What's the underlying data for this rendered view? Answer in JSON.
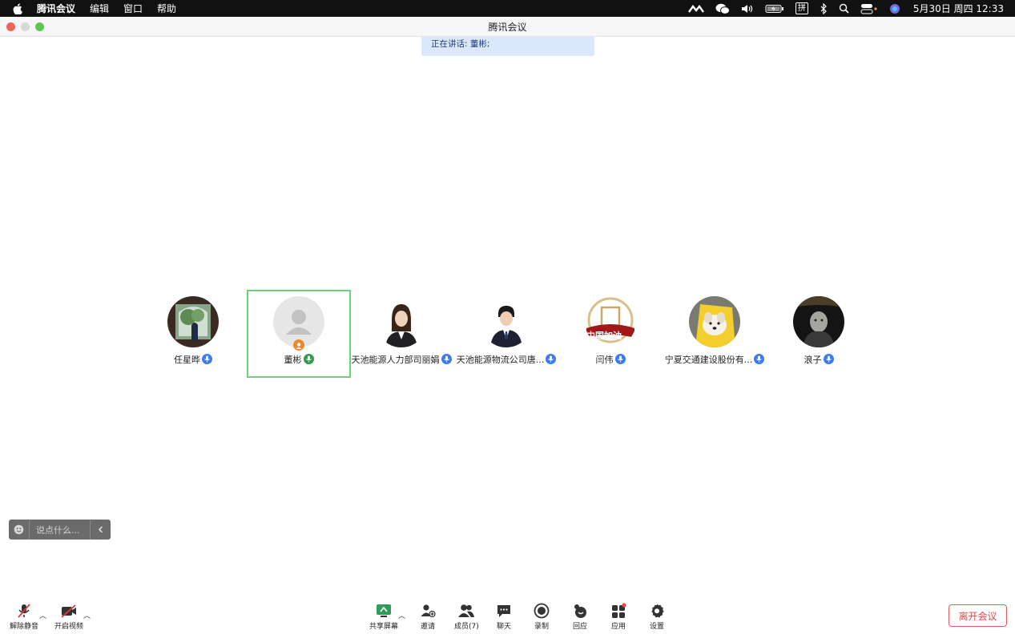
{
  "menubar": {
    "items": [
      "腾讯会议",
      "编辑",
      "窗口",
      "帮助"
    ],
    "status_icons": [
      "app-icon",
      "wechat-icon",
      "volume-icon",
      "battery-icon",
      "input-method-icon",
      "bluetooth-icon",
      "search-icon",
      "control-center-icon",
      "siri-icon"
    ],
    "input_method": "拼",
    "clock": "5月30日 周四  12:33"
  },
  "window": {
    "title": "腾讯会议"
  },
  "speaking": {
    "text": "正在讲话: 董彬;"
  },
  "participants": [
    {
      "name": "任星晔",
      "mic": "blue"
    },
    {
      "name": "董彬",
      "mic": "green",
      "active": true,
      "host": true
    },
    {
      "name": "天池能源人力部司丽娟",
      "mic": "blue"
    },
    {
      "name": "天池能源物流公司唐...",
      "mic": "blue"
    },
    {
      "name": "闫伟",
      "mic": "blue"
    },
    {
      "name": "宁夏交通建设股份有...",
      "mic": "blue"
    },
    {
      "name": "浪子",
      "mic": "blue"
    }
  ],
  "avatar_texts": {
    "yanwei": "中国加油"
  },
  "chat": {
    "placeholder": "说点什么..."
  },
  "toolbar": {
    "unmute": "解除静音",
    "video": "开启视频",
    "share": "共享屏幕",
    "invite": "邀请",
    "members": "成员(7)",
    "chat": "聊天",
    "record": "录制",
    "respond": "回应",
    "apps": "应用",
    "settings": "设置",
    "leave": "离开会议"
  },
  "colors": {
    "active_border": "#6fd07a",
    "mic_blue": "#3b7bf0",
    "mic_green": "#2e9e48",
    "leave_red": "#e14c4c"
  }
}
